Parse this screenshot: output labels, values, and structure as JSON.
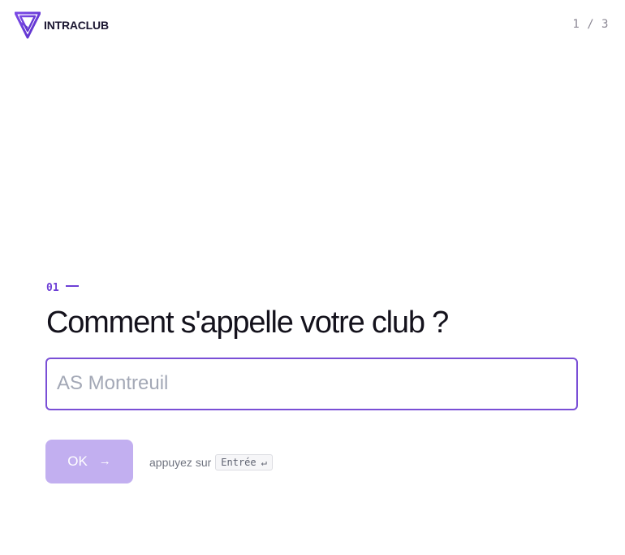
{
  "header": {
    "brand": "INTRACLUB",
    "step_counter": "1 / 3"
  },
  "question": {
    "number": "01",
    "title": "Comment s'appelle votre club ?",
    "input_value": "",
    "input_placeholder": "AS Montreuil"
  },
  "actions": {
    "ok_label": "OK",
    "ok_icon": "arrow-right-icon",
    "hint_prefix": "appuyez sur",
    "hint_key": "Entrée",
    "hint_key_icon": "↵"
  },
  "colors": {
    "accent": "#6d3fd6",
    "input_border": "#7a4fd6",
    "button_disabled": "#c2aff0",
    "text": "#14121c",
    "muted": "#8b8794"
  }
}
